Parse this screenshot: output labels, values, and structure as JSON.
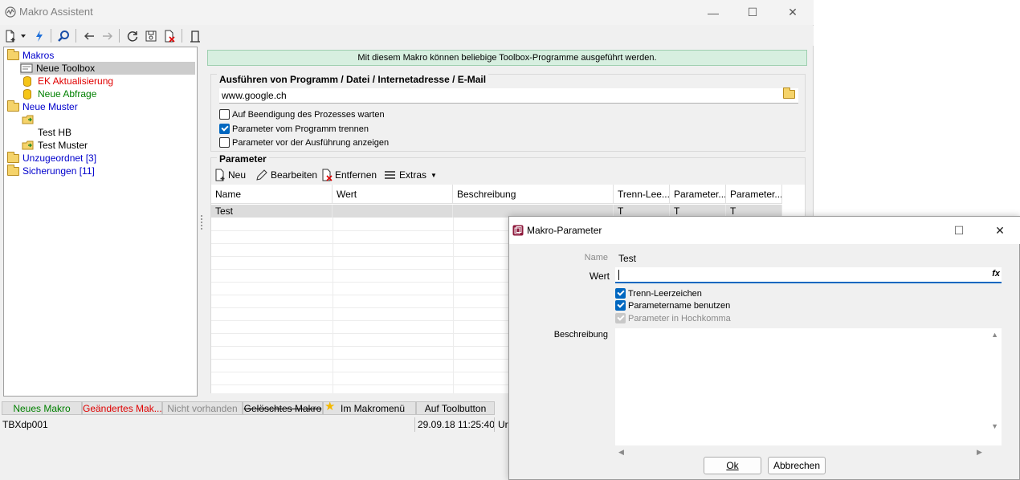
{
  "window": {
    "title": "Makro Assistent",
    "controls": {
      "minimize": "—",
      "maximize": "☐",
      "close": "✕"
    }
  },
  "toolbar": {
    "icons": [
      "new-icon",
      "dropdown-icon",
      "run-icon",
      "search-icon",
      "back-icon",
      "forward-icon",
      "refresh-icon",
      "save-icon",
      "delete-icon",
      "exit-icon"
    ]
  },
  "tree": {
    "items": [
      {
        "label": "Makros",
        "color": "#0000cc"
      },
      {
        "label": "Neue Toolbox",
        "color": "#000000",
        "selected": true
      },
      {
        "label": "EK Aktualisierung",
        "color": "#e00000"
      },
      {
        "label": "Neue Abfrage",
        "color": "#008000"
      },
      {
        "label": "Neue Muster",
        "color": "#0000cc"
      },
      {
        "label": "",
        "color": "#000000"
      },
      {
        "label": "Test HB",
        "color": "#000000"
      },
      {
        "label": "Test Muster",
        "color": "#000000"
      },
      {
        "label": "Unzugeordnet [3]",
        "color": "#0000cc"
      },
      {
        "label": "Sicherungen [11]",
        "color": "#0000cc"
      }
    ]
  },
  "info_banner": "Mit diesem Makro können beliebige Toolbox-Programme ausgeführt werden.",
  "exec_group": {
    "title": "Ausführen von Programm / Datei / Internetadresse / E-Mail",
    "url": "www.google.ch",
    "options": [
      {
        "label": "Auf Beendigung des Prozesses warten",
        "checked": false
      },
      {
        "label": "Parameter vom Programm trennen",
        "checked": true
      },
      {
        "label": "Parameter vor der Ausführung anzeigen",
        "checked": false
      }
    ]
  },
  "param_group": {
    "title": "Parameter",
    "toolbar": {
      "new": "Neu",
      "edit": "Bearbeiten",
      "remove": "Entfernen",
      "extras": "Extras"
    },
    "columns": [
      "Name",
      "Wert",
      "Beschreibung",
      "Trenn-Lee...",
      "Parameter...",
      "Parameter..."
    ],
    "rows": [
      [
        "Test",
        "",
        "",
        "T",
        "T",
        "T"
      ]
    ]
  },
  "legend": {
    "new": "Neues Makro",
    "changed": "Geändertes Mak...",
    "missing": "Nicht vorhanden",
    "deleted": "Gelöschtes Makro",
    "in_menu": "Im Makromenü",
    "on_button": "Auf Toolbutton"
  },
  "statusbar": {
    "id": "TBXdp001",
    "timestamp": "29.09.18 11:25:40",
    "user": "Ur"
  },
  "dialog": {
    "title": "Makro-Parameter",
    "name_label": "Name",
    "name_value": "Test",
    "wert_label": "Wert",
    "wert_value": "",
    "fx": "fx",
    "options": [
      {
        "label": "Trenn-Leerzeichen",
        "checked": true,
        "disabled": false
      },
      {
        "label": "Parametername benutzen",
        "checked": true,
        "disabled": false
      },
      {
        "label": "Parameter in Hochkomma",
        "checked": true,
        "disabled": true
      }
    ],
    "desc_label": "Beschreibung",
    "ok": "Ok",
    "cancel": "Abbrechen"
  }
}
